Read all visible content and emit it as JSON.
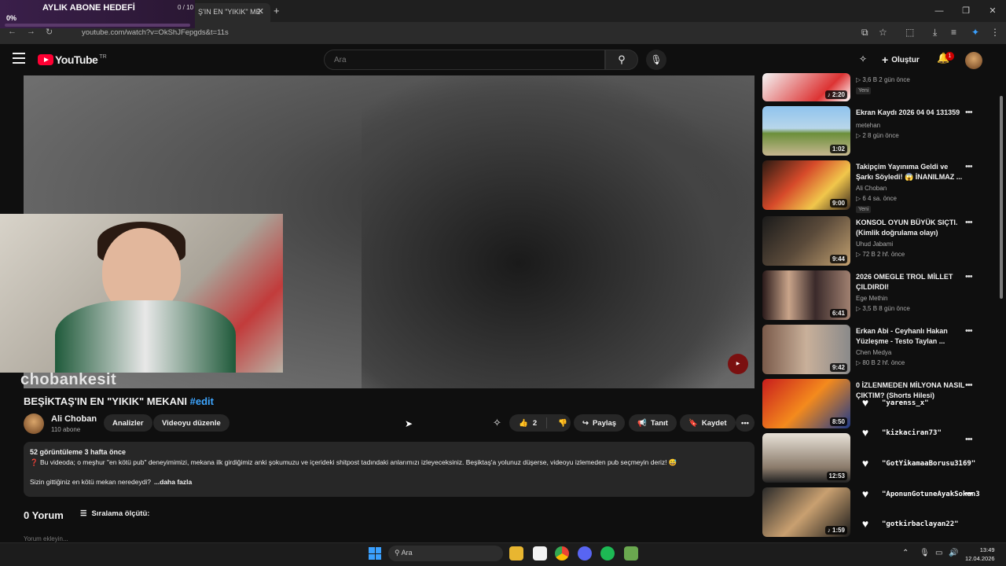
{
  "browser": {
    "tab_title": "Ş'IN EN \"YIKIK\" ME",
    "url": "youtube.com/watch?v=OkShJFepgds&t=11s"
  },
  "goal_overlay": {
    "title": "AYLIK ABONE HEDEFİ",
    "count": "0 / 10",
    "percent": "0%",
    "progress": 0
  },
  "header": {
    "logo": "YouTube",
    "country": "TR",
    "search_placeholder": "Ara",
    "create_label": "Oluştur",
    "notifications": "1"
  },
  "webcam": {
    "name": "chobankesit"
  },
  "video": {
    "title": "BEŞİKTAŞ'IN EN \"YIKIK\" MEKANI",
    "hashtag": "#edit",
    "channel": "Ali Choban",
    "subscribers": "110 abone",
    "analytics_label": "Analizler",
    "edit_label": "Videoyu düzenle",
    "likes": "2",
    "share_label": "Paylaş",
    "promote_label": "Tanıt",
    "save_label": "Kaydet",
    "stats": "52 görüntüleme  3 hafta önce",
    "description": "❓ Bu videoda; o meşhur \"en kötü pub\" deneyimimizi, mekana ilk girdiğimiz anki şokumuzu ve içerideki shitpost tadındaki anlarımızı izleyeceksiniz. Beşiktaş'a yolunuz düşerse, videoyu izlemeden pub seçmeyin deriz! 😅",
    "question": "Sizin gittiğiniz en kötü mekan neredeydi?",
    "more": "...daha fazla",
    "comments_count": "0 Yorum",
    "sort_label": "Sıralama ölçütü:",
    "add_comment": "Yorum ekleyin..."
  },
  "recommendations": [
    {
      "title": "",
      "channel": "",
      "meta": "▷ 3,6 B  2 gün önce",
      "badge": "Yeni",
      "duration": "♪ 2:20"
    },
    {
      "title": "Ekran Kaydı 2026 04 04 131359",
      "channel": "metehan",
      "meta": "▷ 2  8 gün önce",
      "badge": "",
      "duration": "1:02"
    },
    {
      "title": "Takipçim Yayınıma Geldi ve Şarkı Söyledi! 😱 İNANILMAZ ...",
      "channel": "Ali Choban",
      "meta": "▷ 6  4 sa. önce",
      "badge": "Yeni",
      "duration": "9:00"
    },
    {
      "title": "KONSOL OYUN BÜYÜK SIÇTI. (Kimlik doğrulama olayı)",
      "channel": "Uhud Jabami",
      "meta": "▷ 72 B  2 hf. önce",
      "badge": "",
      "duration": "9:44"
    },
    {
      "title": "2026 OMEGLE TROL MİLLET ÇILDIRDI!",
      "channel": "Ege Methin",
      "meta": "▷ 3,5 B  8 gün önce",
      "badge": "",
      "duration": "6:41"
    },
    {
      "title": "Erkan Abi - Ceyhanlı Hakan Yüzleşme - Testo Taylan ...",
      "channel": "Chen Medya",
      "meta": "▷ 80 B  2 hf. önce",
      "badge": "",
      "duration": "9:42"
    },
    {
      "title": "0 İZLENMEDEN MİLYONA NASIL ÇIKTIM? (Shorts Hilesi)",
      "channel": "",
      "meta": "",
      "badge": "",
      "duration": "8:50"
    },
    {
      "title": "",
      "channel": "",
      "meta": "",
      "badge": "",
      "duration": "12:53"
    },
    {
      "title": "",
      "channel": "",
      "meta": "",
      "badge": "",
      "duration": "♪ 1:59"
    }
  ],
  "chat": [
    {
      "msg": "\"yarenss_x\""
    },
    {
      "msg": "\"kizkaciran73\""
    },
    {
      "msg": "\"GotYikamaaBorusu3169\""
    },
    {
      "msg": "\"AponunGotuneAyakSokan3"
    },
    {
      "msg": "\"gotkirbaclayan22\""
    }
  ],
  "taskbar": {
    "search": "Ara",
    "time": "13:49",
    "date": "12.04.2026"
  },
  "colors": {
    "accent": "#3ea6ff",
    "brand": "#ff0033",
    "bg": "#0f0f0f"
  }
}
